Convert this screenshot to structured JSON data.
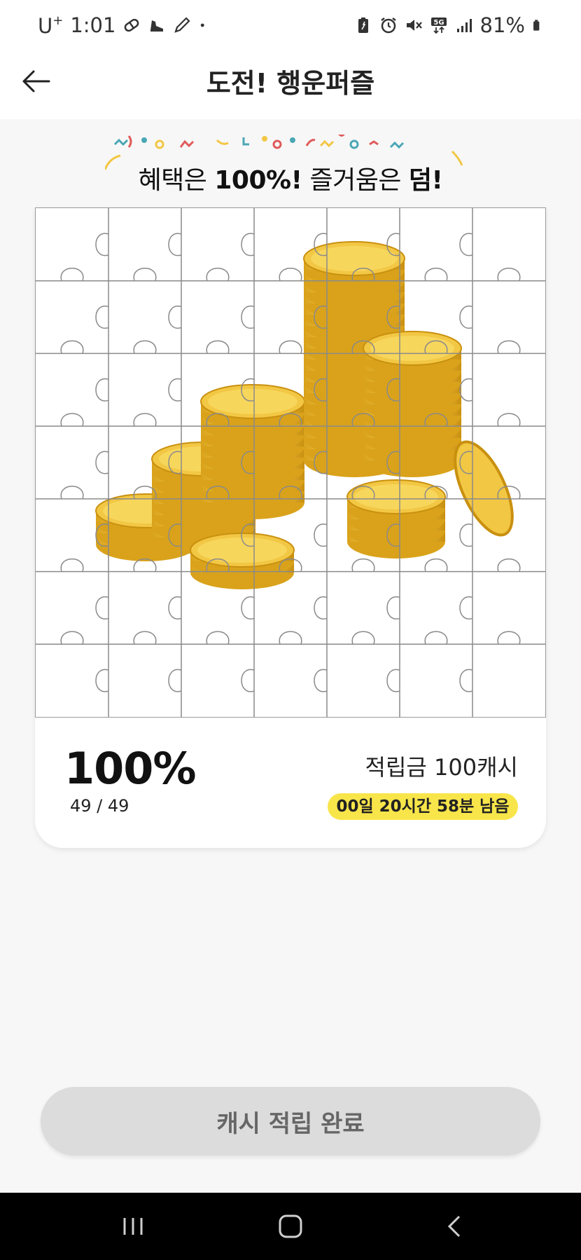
{
  "status_bar": {
    "carrier": "U",
    "carrier_sup": "+",
    "time": "1:01",
    "battery": "81%"
  },
  "header": {
    "title": "도전! 행운퍼즐"
  },
  "tagline": {
    "part1": "혜택은 ",
    "highlight1": "100%!",
    "part2": " 즐거움은 ",
    "highlight2": "덤!"
  },
  "puzzle": {
    "rows": 7,
    "cols": 7,
    "image": "gold-coin-stacks"
  },
  "progress": {
    "percent_label": "100%",
    "pieces_label": "49 / 49",
    "reward_label": "적립금 100캐시",
    "time_left_label": "00일 20시간 58분 남음"
  },
  "actions": {
    "complete_label": "캐시 적립 완료"
  },
  "nav": {
    "icons": [
      "recent-apps-icon",
      "home-icon",
      "back-icon"
    ]
  },
  "colors": {
    "badge": "#f8e54a",
    "coin": "#f2c744",
    "button_disabled": "#dcdcdc",
    "confetti": [
      "#e05a5a",
      "#4aa7b5",
      "#f2c744",
      "#e6b800"
    ]
  }
}
